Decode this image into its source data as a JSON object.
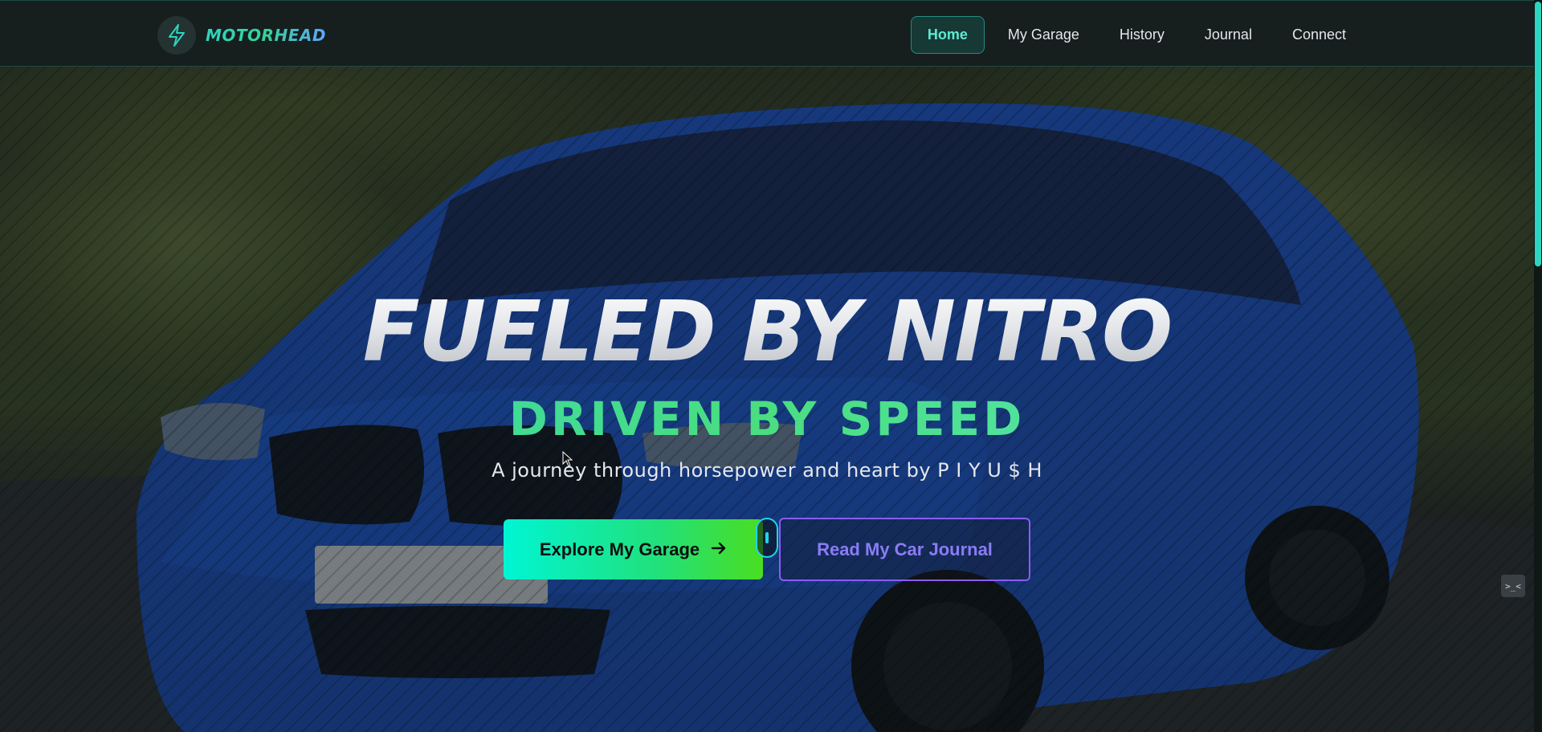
{
  "brand": {
    "name": "MOTORHEAD",
    "icon": "lightning-bolt-icon"
  },
  "nav": {
    "items": [
      {
        "label": "Home",
        "active": true
      },
      {
        "label": "My Garage",
        "active": false
      },
      {
        "label": "History",
        "active": false
      },
      {
        "label": "Journal",
        "active": false
      },
      {
        "label": "Connect",
        "active": false
      }
    ]
  },
  "hero": {
    "title": "FUELED BY NITRO",
    "subtitle": "DRIVEN BY SPEED",
    "tagline": "A journey through horsepower and heart by P I Y U $ H",
    "primary_cta": {
      "label": "Explore My Garage",
      "icon": "arrow-right-icon"
    },
    "secondary_cta": {
      "label": "Read My Car Journal"
    }
  },
  "side_widget": {
    "label": ">_<"
  },
  "colors": {
    "accent_teal": "#2dd4bf",
    "accent_green": "#4ade80",
    "accent_purple": "#8b5cf6",
    "nav_bg": "#161e1e"
  }
}
